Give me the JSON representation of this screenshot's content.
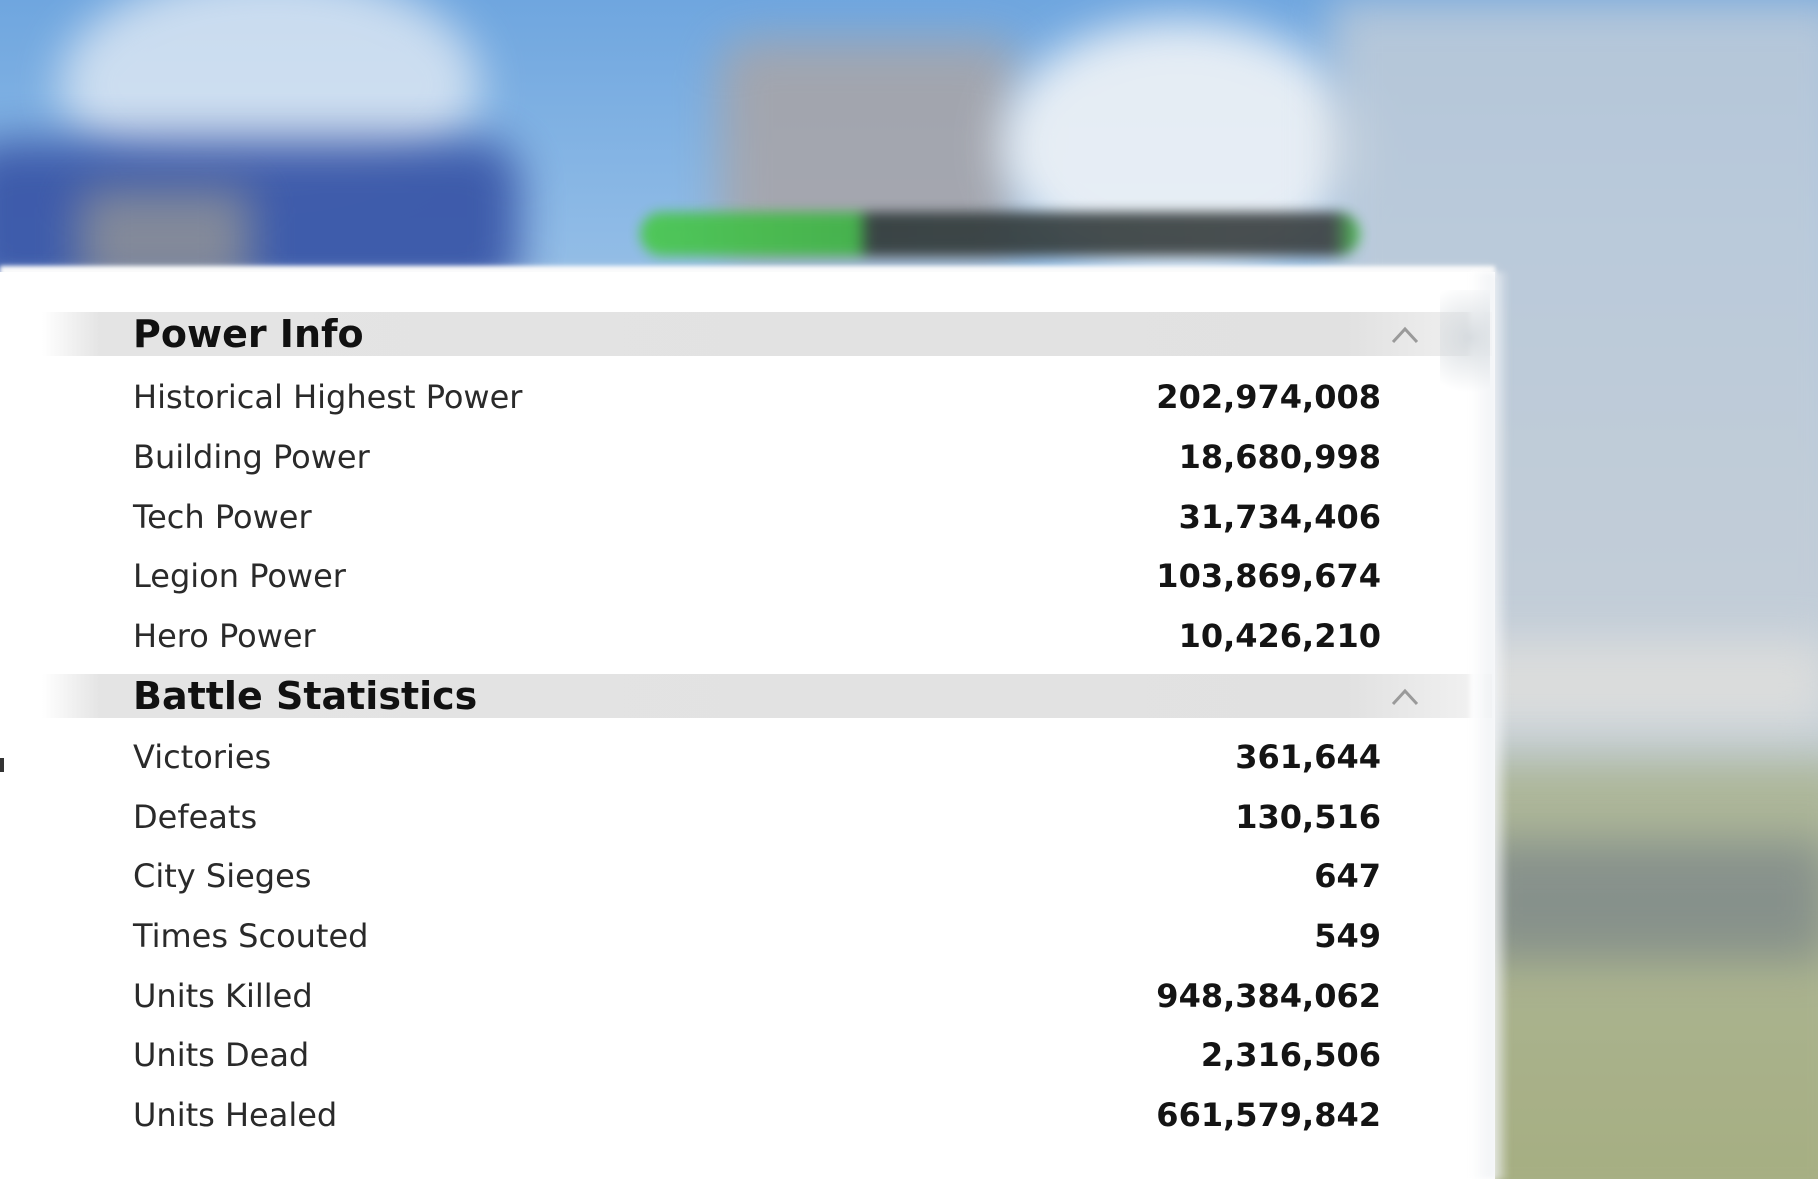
{
  "sections": [
    {
      "title": "Power Info",
      "rows": [
        {
          "label": "Historical Highest Power",
          "value": "202,974,008"
        },
        {
          "label": "Building Power",
          "value": "18,680,998"
        },
        {
          "label": "Tech Power",
          "value": "31,734,406"
        },
        {
          "label": "Legion Power",
          "value": "103,869,674"
        },
        {
          "label": "Hero Power",
          "value": "10,426,210"
        }
      ]
    },
    {
      "title": "Battle Statistics",
      "rows": [
        {
          "label": "Victories",
          "value": "361,644"
        },
        {
          "label": "Defeats",
          "value": "130,516"
        },
        {
          "label": "City Sieges",
          "value": "647"
        },
        {
          "label": "Times Scouted",
          "value": "549"
        },
        {
          "label": "Units Killed",
          "value": "948,384,062"
        },
        {
          "label": "Units Dead",
          "value": "2,316,506"
        },
        {
          "label": "Units Healed",
          "value": "661,579,842"
        }
      ]
    }
  ],
  "colors": {
    "panel_background": "#ffffff",
    "section_header_background": "#e1e1e1",
    "label_text": "#2a2a2a",
    "value_text": "#141414",
    "chevron": "#9a9a9a"
  },
  "icons": {
    "collapse": "chevron-up-icon"
  }
}
